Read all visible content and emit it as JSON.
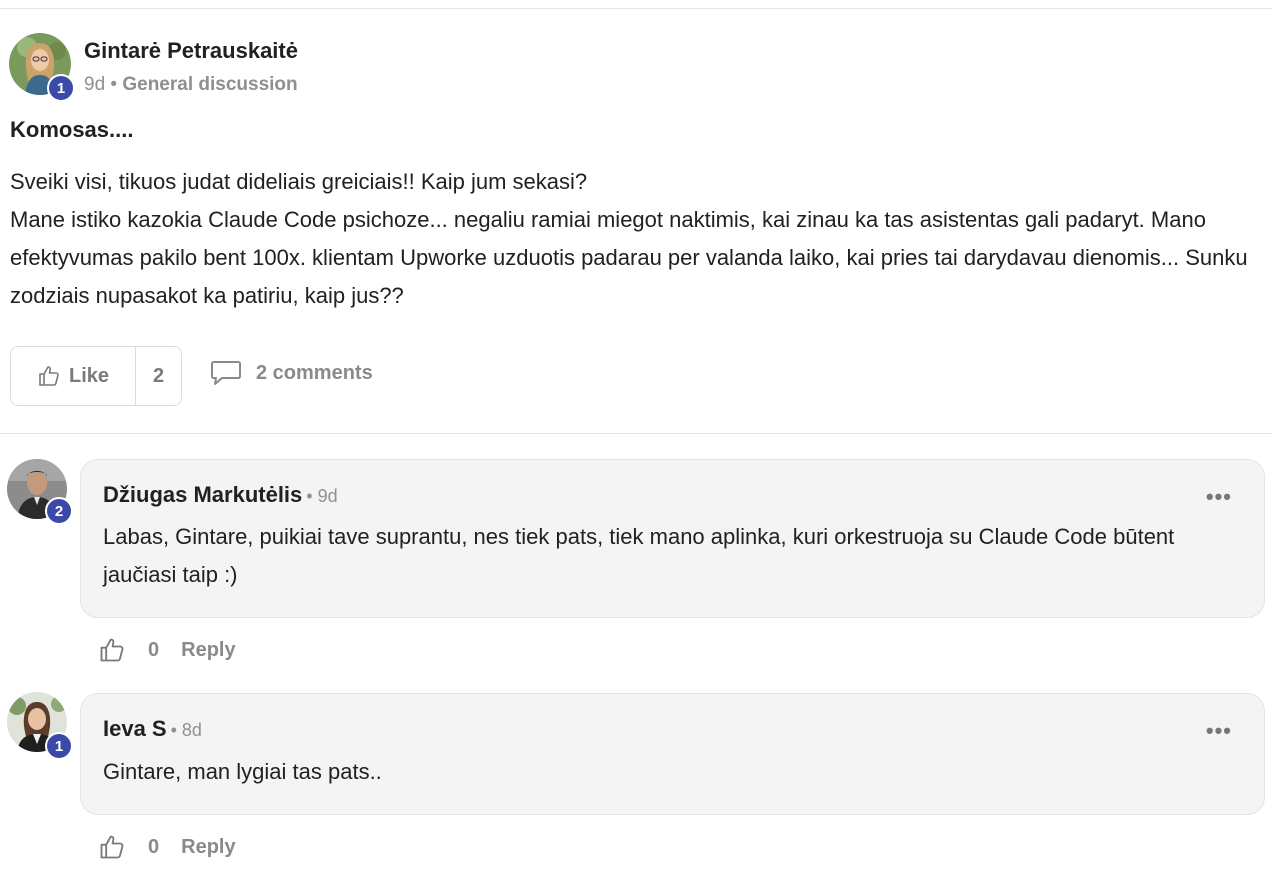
{
  "post": {
    "author": "Gintarė Petrauskaitė",
    "level": "1",
    "age": "9d",
    "separator": "•",
    "category": "General discussion",
    "title": "Komosas....",
    "body_lines": [
      "Sveiki visi, tikuos judat dideliais greiciais!! Kaip jum sekasi?",
      "Mane istiko kazokia Claude Code psichoze... negaliu ramiai miegot naktimis, kai zinau ka tas asistentas gali padaryt. Mano efektyvumas pakilo bent 100x. klientam Upworke uzduotis padarau per valanda laiko, kai pries tai darydavau dienomis... Sunku zodziais nupasakot ka patiriu, kaip jus??"
    ],
    "like_label": "Like",
    "like_count": "2",
    "comments_label": "2 comments"
  },
  "comments": [
    {
      "author": "Džiugas Markutėlis",
      "time": "• 9d",
      "level": "2",
      "text": "Labas, Gintare, puikiai tave suprantu, nes tiek pats, tiek mano aplinka, kuri orkestruoja su Claude Code būtent jaučiasi taip :)",
      "likes": "0",
      "reply_label": "Reply",
      "menu": "•••"
    },
    {
      "author": "Ieva S",
      "time": "• 8d",
      "level": "1",
      "text": "Gintare, man lygiai tas pats..",
      "likes": "0",
      "reply_label": "Reply",
      "menu": "•••"
    }
  ],
  "colors": {
    "badge": "#3b4aa8",
    "muted_text": "#8a8a8a",
    "bubble_bg": "#f4f4f4"
  }
}
